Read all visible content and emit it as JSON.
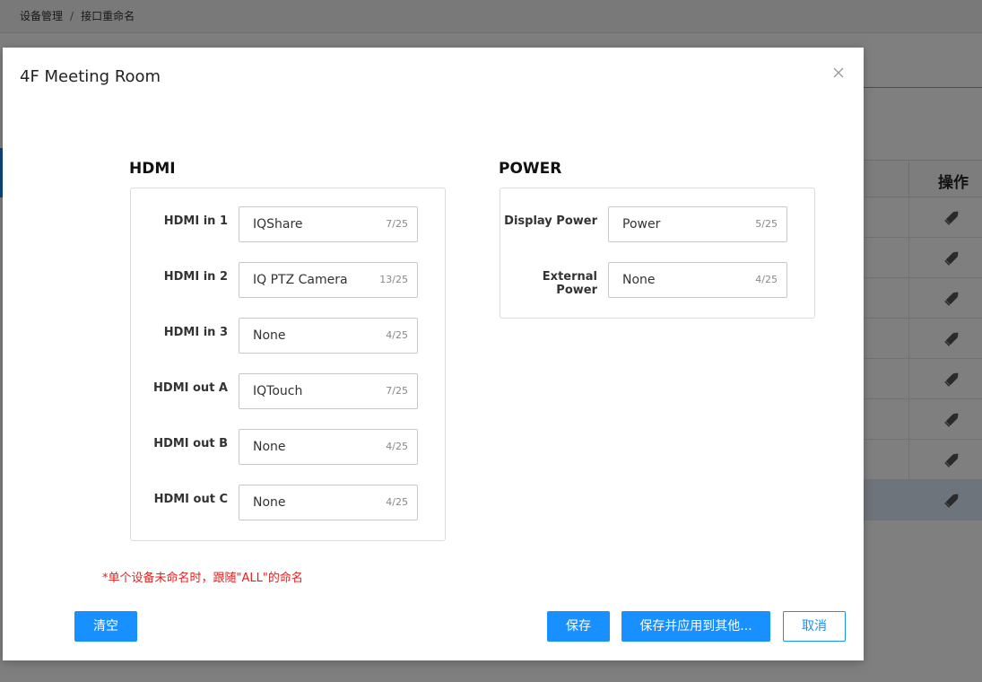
{
  "breadcrumb": {
    "root": "设备管理",
    "separator": "/",
    "current": "接口重命名"
  },
  "background_table": {
    "action_header": "操作",
    "row_count": 8,
    "selected_row": 7
  },
  "modal": {
    "title": "4F Meeting Room",
    "hdmi": {
      "title": "HDMI",
      "rows": [
        {
          "label": "HDMI in 1",
          "value": "IQShare",
          "count": "7/25"
        },
        {
          "label": "HDMI in 2",
          "value": "IQ PTZ Camera",
          "count": "13/25"
        },
        {
          "label": "HDMI in 3",
          "value": "None",
          "count": "4/25"
        },
        {
          "label": "HDMI out A",
          "value": "IQTouch",
          "count": "7/25"
        },
        {
          "label": "HDMI out B",
          "value": "None",
          "count": "4/25"
        },
        {
          "label": "HDMI out C",
          "value": "None",
          "count": "4/25"
        }
      ]
    },
    "power": {
      "title": "POWER",
      "rows": [
        {
          "label": "Display Power",
          "value": "Power",
          "count": "5/25"
        },
        {
          "label": "External Power",
          "value": "None",
          "count": "4/25"
        }
      ]
    },
    "note": "*单个设备未命名时，跟随\"ALL\"的命名",
    "buttons": {
      "clear": "清空",
      "save": "保存",
      "save_apply": "保存并应用到其他...",
      "cancel": "取消"
    }
  },
  "colors": {
    "primary": "#1890ff",
    "note_red": "#e02020",
    "overlay": "rgba(0,0,0,0.5)"
  }
}
